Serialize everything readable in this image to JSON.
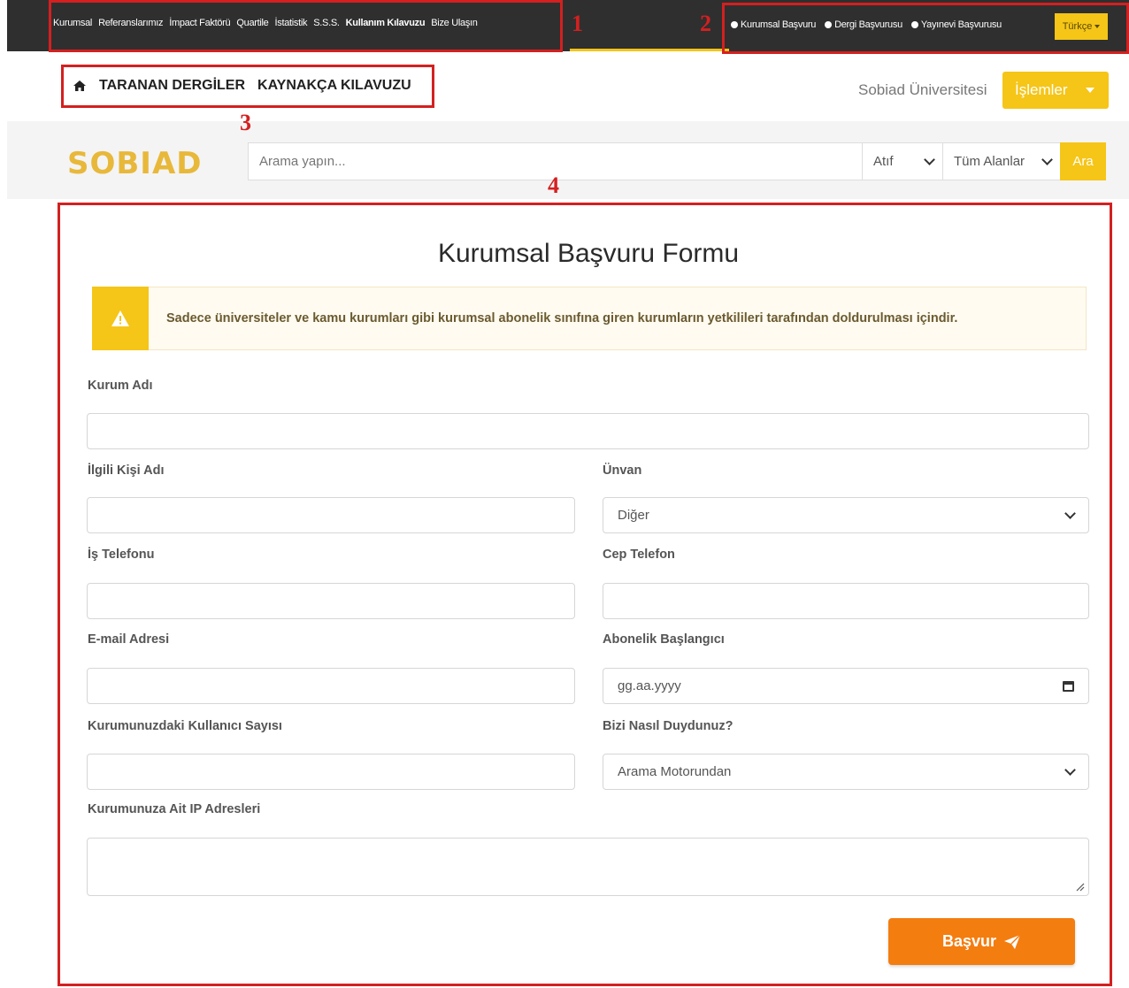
{
  "top_nav": {
    "links": [
      "Kurumsal",
      "Referanslarımız",
      "İmpact Faktörü",
      "Quartile",
      "İstatistik",
      "S.S.S.",
      "Kullanım Kılavuzu",
      "Bize Ulaşın"
    ],
    "apply_links": [
      "Kurumsal Başvuru",
      "Dergi Başvurusu",
      "Yayınevi Başvurusu"
    ],
    "language": "Türkçe"
  },
  "annotations": [
    "1",
    "2",
    "3",
    "4"
  ],
  "breadcrumb": {
    "items": [
      "TARANAN DERGİLER",
      "KAYNAKÇA KILAVUZU"
    ]
  },
  "header": {
    "university": "Sobiad Üniversitesi",
    "actions_label": "İşlemler"
  },
  "search": {
    "logo": "SOBIAD",
    "placeholder": "Arama yapın...",
    "type_select": "Atıf",
    "field_select": "Tüm Alanlar",
    "button": "Ara"
  },
  "form": {
    "title": "Kurumsal Başvuru Formu",
    "alert": "Sadece üniversiteler ve kamu kurumları gibi kurumsal abonelik sınıfına giren kurumların yetkilileri tarafından doldurulması içindir.",
    "labels": {
      "institution": "Kurum Adı",
      "contact_name": "İlgili Kişi Adı",
      "title": "Ünvan",
      "work_phone": "İş Telefonu",
      "mobile_phone": "Cep Telefon",
      "email": "E-mail Adresi",
      "subscription_start": "Abonelik Başlangıcı",
      "user_count": "Kurumunuzdaki Kullanıcı Sayısı",
      "referral": "Bizi Nasıl Duydunuz?",
      "ip_addresses": "Kurumunuza Ait IP Adresleri"
    },
    "values": {
      "title": "Diğer",
      "subscription_start_placeholder": "gg.aa.yyyy",
      "referral": "Arama Motorundan"
    },
    "submit": "Başvur"
  },
  "colors": {
    "accent": "#f5c518",
    "submit": "#f47d10",
    "annotation": "#d42020",
    "topbar": "#2f2f2f"
  }
}
